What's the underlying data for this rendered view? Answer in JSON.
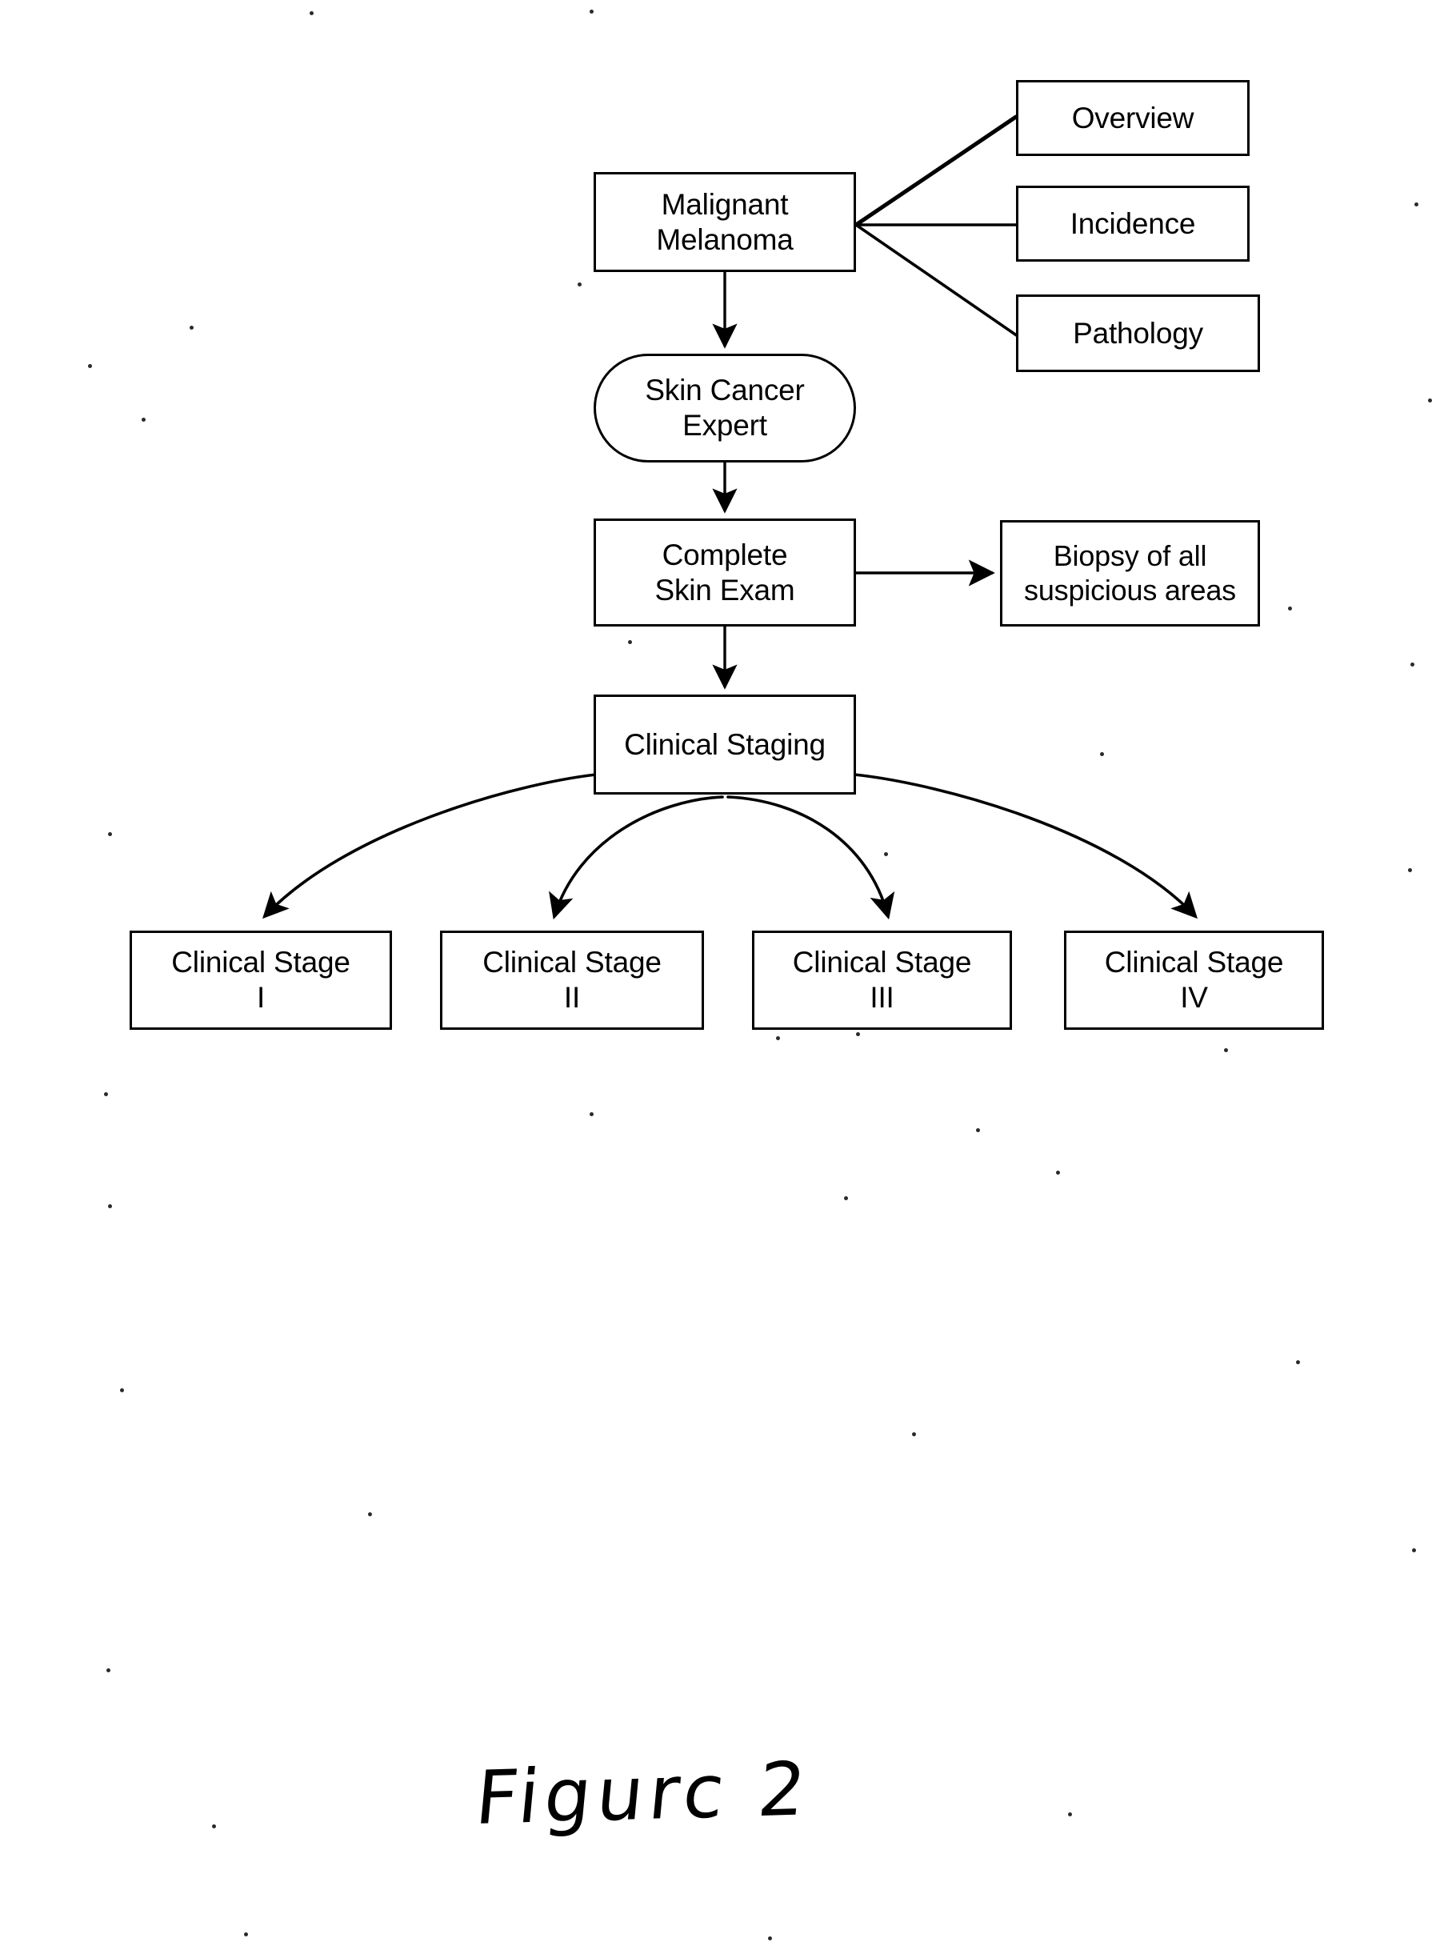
{
  "document": {
    "caption": "Figurc 2",
    "caption_meaning": "Figure 2",
    "background_color": "#ffffff",
    "ink_color": "#000000"
  },
  "diagram": {
    "type": "flowchart",
    "title": "Malignant Melanoma clinical workflow",
    "nodes": [
      {
        "id": "melanoma",
        "label": "Malignant\nMelanoma",
        "shape": "rectangle"
      },
      {
        "id": "overview",
        "label": "Overview",
        "shape": "rectangle"
      },
      {
        "id": "incidence",
        "label": "Incidence",
        "shape": "rectangle"
      },
      {
        "id": "pathology",
        "label": "Pathology",
        "shape": "rectangle"
      },
      {
        "id": "expert",
        "label": "Skin Cancer\nExpert",
        "shape": "stadium"
      },
      {
        "id": "skinexam",
        "label": "Complete\nSkin Exam",
        "shape": "rectangle"
      },
      {
        "id": "biopsy",
        "label": "Biopsy of all\nsuspicious areas",
        "shape": "rectangle"
      },
      {
        "id": "staging",
        "label": "Clinical Staging",
        "shape": "rectangle"
      },
      {
        "id": "stage1",
        "label": "Clinical Stage\nI",
        "shape": "rectangle"
      },
      {
        "id": "stage2",
        "label": "Clinical Stage\nII",
        "shape": "rectangle"
      },
      {
        "id": "stage3",
        "label": "Clinical Stage\nIII",
        "shape": "rectangle"
      },
      {
        "id": "stage4",
        "label": "Clinical Stage\nIV",
        "shape": "rectangle"
      }
    ],
    "edges": [
      {
        "from": "melanoma",
        "to": "overview",
        "style": "plain-line",
        "arrowhead": false
      },
      {
        "from": "melanoma",
        "to": "incidence",
        "style": "plain-line",
        "arrowhead": false
      },
      {
        "from": "melanoma",
        "to": "pathology",
        "style": "plain-line",
        "arrowhead": false
      },
      {
        "from": "melanoma",
        "to": "expert",
        "style": "straight",
        "arrowhead": true
      },
      {
        "from": "expert",
        "to": "skinexam",
        "style": "straight",
        "arrowhead": true
      },
      {
        "from": "skinexam",
        "to": "biopsy",
        "style": "straight",
        "arrowhead": true
      },
      {
        "from": "skinexam",
        "to": "staging",
        "style": "straight",
        "arrowhead": true
      },
      {
        "from": "staging",
        "to": "stage1",
        "style": "curved",
        "arrowhead": true
      },
      {
        "from": "staging",
        "to": "stage2",
        "style": "curved",
        "arrowhead": true
      },
      {
        "from": "staging",
        "to": "stage3",
        "style": "curved",
        "arrowhead": true
      },
      {
        "from": "staging",
        "to": "stage4",
        "style": "curved",
        "arrowhead": true
      }
    ]
  }
}
